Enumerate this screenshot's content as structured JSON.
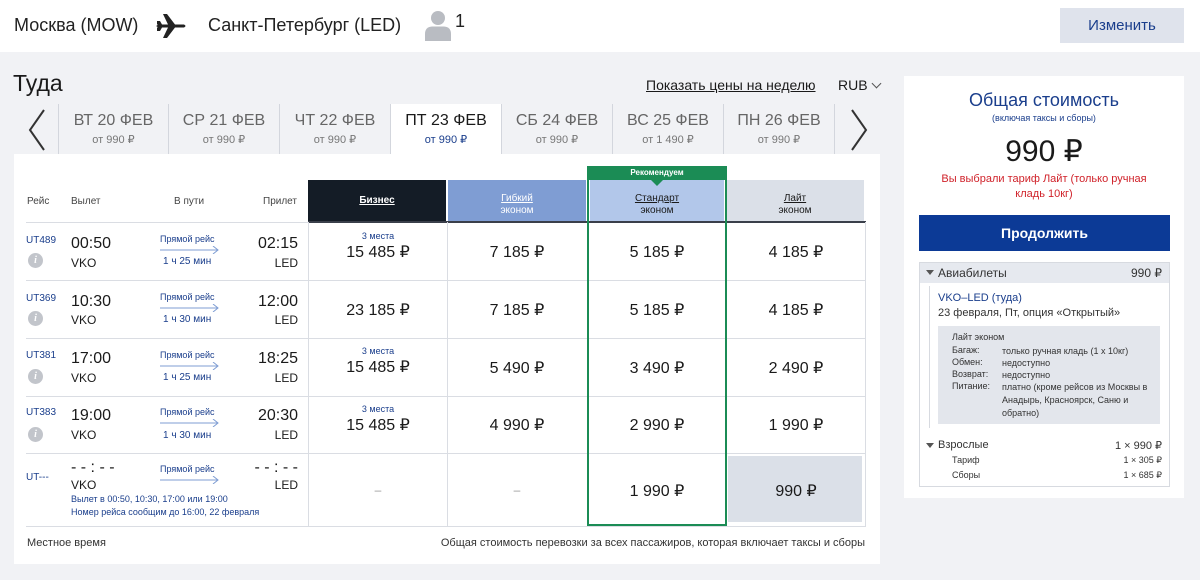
{
  "header": {
    "from": "Москва (MOW)",
    "to": "Санкт-Петербург (LED)",
    "passengers": "1",
    "change_label": "Изменить"
  },
  "direction": {
    "title": "Туда",
    "week_link": "Показать цены на неделю",
    "currency": "RUB"
  },
  "dates": [
    {
      "label": "ВТ 20 ФЕВ",
      "price": "от 990 ₽"
    },
    {
      "label": "СР 21 ФЕВ",
      "price": "от 990 ₽"
    },
    {
      "label": "ЧТ 22 ФЕВ",
      "price": "от 990 ₽"
    },
    {
      "label": "ПТ 23 ФЕВ",
      "price": "от 990 ₽",
      "active": true
    },
    {
      "label": "СБ 24 ФЕВ",
      "price": "от 990 ₽"
    },
    {
      "label": "ВС 25 ФЕВ",
      "price": "от 1 490 ₽"
    },
    {
      "label": "ПН 26 ФЕВ",
      "price": "от 990 ₽"
    }
  ],
  "columns": {
    "flight": "Рейс",
    "departure": "Вылет",
    "duration": "В пути",
    "arrival": "Прилет"
  },
  "fares": {
    "recommended": "Рекомендуем",
    "business": {
      "name": "Бизнес",
      "sub": ""
    },
    "flex": {
      "name": "Гибкий",
      "sub": "эконом"
    },
    "standard": {
      "name": "Стандарт",
      "sub": "эконом"
    },
    "light": {
      "name": "Лайт",
      "sub": "эконом"
    }
  },
  "flights": [
    {
      "no": "UT489",
      "dep": "00:50",
      "dep_ap": "VKO",
      "direct": "Прямой рейс",
      "dur": "1 ч 25 мин",
      "arr": "02:15",
      "arr_ap": "LED",
      "business": "15 485 ₽",
      "business_seats": "3 места",
      "flex": "7 185 ₽",
      "standard": "5 185 ₽",
      "light": "4 185 ₽"
    },
    {
      "no": "UT369",
      "dep": "10:30",
      "dep_ap": "VKO",
      "direct": "Прямой рейс",
      "dur": "1 ч 30 мин",
      "arr": "12:00",
      "arr_ap": "LED",
      "business": "23 185 ₽",
      "business_seats": "",
      "flex": "7 185 ₽",
      "standard": "5 185 ₽",
      "light": "4 185 ₽"
    },
    {
      "no": "UT381",
      "dep": "17:00",
      "dep_ap": "VKO",
      "direct": "Прямой рейс",
      "dur": "1 ч 25 мин",
      "arr": "18:25",
      "arr_ap": "LED",
      "business": "15 485 ₽",
      "business_seats": "3 места",
      "flex": "5 490 ₽",
      "standard": "3 490 ₽",
      "light": "2 490 ₽"
    },
    {
      "no": "UT383",
      "dep": "19:00",
      "dep_ap": "VKO",
      "direct": "Прямой рейс",
      "dur": "1 ч 30 мин",
      "arr": "20:30",
      "arr_ap": "LED",
      "business": "15 485 ₽",
      "business_seats": "3 места",
      "flex": "4 990 ₽",
      "standard": "2 990 ₽",
      "light": "1 990 ₽"
    }
  ],
  "unknown_flight": {
    "no": "UT---",
    "dep": "- - : - -",
    "dep_ap": "VKO",
    "direct": "Прямой рейс",
    "arr": "- - : - -",
    "arr_ap": "LED",
    "note1": "Вылет в 00:50, 10:30, 17:00 или 19:00",
    "note2": "Номер рейса сообщим до 16:00, 22 февраля",
    "business": "–",
    "flex": "–",
    "standard": "1 990 ₽",
    "light": "990 ₽"
  },
  "footer": {
    "left": "Местное время",
    "right": "Общая стоимость перевозки за всех пассажиров, которая включает таксы и сборы"
  },
  "summary": {
    "title": "Общая стоимость",
    "subtitle": "(включая таксы и сборы)",
    "total": "990 ₽",
    "warning": "Вы выбрали тариф Лайт (только ручная кладь 10кг)",
    "continue_label": "Продолжить",
    "tickets_label": "Авиабилеты",
    "tickets_price": "990 ₽",
    "segment": "VKO–LED (туда)",
    "segment_date": "23 февраля, Пт, опция «Открытый»",
    "fare_name": "Лайт эконом",
    "fare_rows": [
      {
        "key": "Багаж:",
        "value": "только ручная кладь (1 х 10кг)"
      },
      {
        "key": "Обмен:",
        "value": "недоступно"
      },
      {
        "key": "Возврат:",
        "value": "недоступно"
      },
      {
        "key": "Питание:",
        "value": "платно (кроме рейсов из Москвы в Анадырь, Красноярск, Саню и обратно)"
      }
    ],
    "adults_label": "Взрослые",
    "adults_value": "1 × 990 ₽",
    "tariff_label": "Тариф",
    "tariff_value": "1 × 305 ₽",
    "fees_label": "Сборы",
    "fees_value": "1 × 685 ₽"
  }
}
